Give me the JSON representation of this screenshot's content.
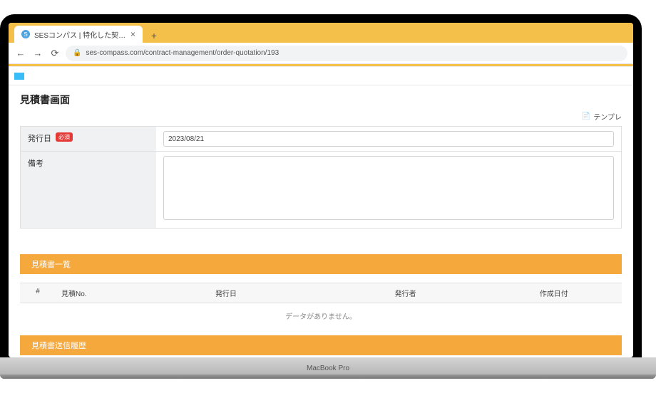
{
  "browser": {
    "tab_title": "SESコンパス | 特化した契約管理・案",
    "url": "ses-compass.com/contract-management/order-quotation/193"
  },
  "page": {
    "title": "見積書画面",
    "template_link": "テンプレ"
  },
  "form": {
    "issue_date_label": "発行日",
    "required_text": "必須",
    "issue_date_value": "2023/08/21",
    "remarks_label": "備考",
    "remarks_value": ""
  },
  "list_section": {
    "header": "見積書一覧",
    "columns": {
      "num": "#",
      "quote_no": "見積No.",
      "issue_date": "発行日",
      "issuer": "発行者",
      "created_at": "作成日付"
    },
    "empty_text": "データがありません。"
  },
  "history_section": {
    "header": "見積書送信履歴"
  },
  "laptop_label": "MacBook Pro"
}
